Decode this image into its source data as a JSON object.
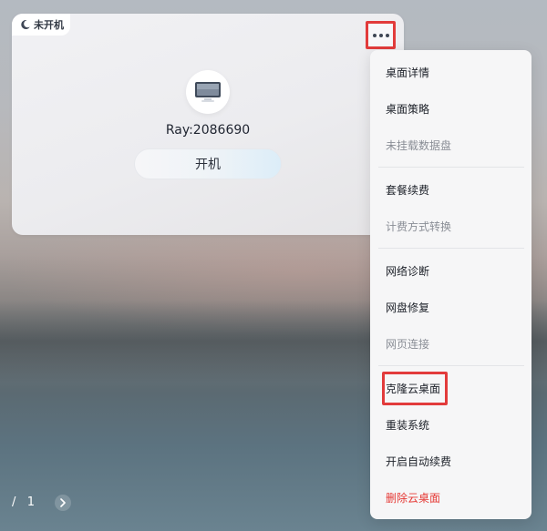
{
  "desktop_card": {
    "status": "未开机",
    "status_icon": "moon-icon",
    "more_icon": "more-icon",
    "device_icon": "monitor-icon",
    "name": "Ray:2086690",
    "power_button_label": "开机"
  },
  "menu": {
    "items": [
      {
        "label": "桌面详情",
        "state": "enabled"
      },
      {
        "label": "桌面策略",
        "state": "enabled"
      },
      {
        "label": "未挂载数据盘",
        "state": "disabled"
      },
      {
        "label": "套餐续费",
        "state": "enabled"
      },
      {
        "label": "计费方式转换",
        "state": "disabled"
      },
      {
        "label": "网络诊断",
        "state": "enabled"
      },
      {
        "label": "网盘修复",
        "state": "enabled"
      },
      {
        "label": "网页连接",
        "state": "disabled"
      },
      {
        "label": "克隆云桌面",
        "state": "highlighted"
      },
      {
        "label": "重装系统",
        "state": "enabled"
      },
      {
        "label": "开启自动续费",
        "state": "enabled"
      },
      {
        "label": "删除云桌面",
        "state": "danger"
      }
    ]
  },
  "pagination": {
    "separator": "/",
    "total": "1",
    "next_icon": "chevron-right-icon"
  },
  "colors": {
    "highlight": "#e23b3b",
    "danger": "#e53935",
    "disabled": "#8a8e96"
  }
}
